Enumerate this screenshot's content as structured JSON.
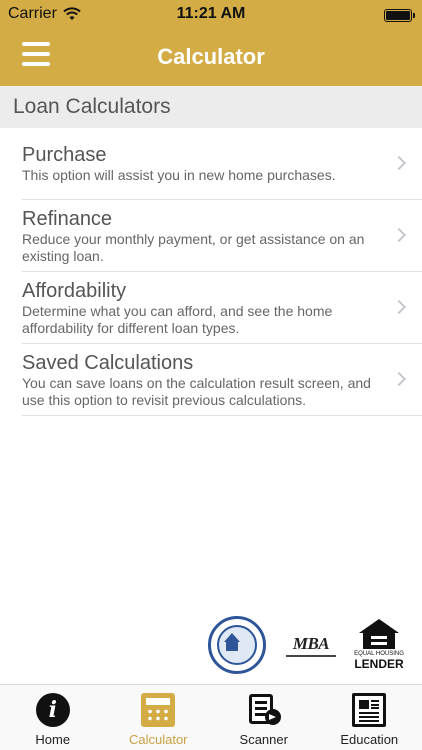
{
  "status_bar": {
    "carrier": "Carrier",
    "time": "11:21 AM"
  },
  "header": {
    "title": "Calculator",
    "menu_icon": "hamburger-menu-icon",
    "background_color": "#d4ac45"
  },
  "section": {
    "title": "Loan Calculators"
  },
  "items": [
    {
      "title": "Purchase",
      "description": "This option will assist you in new home purchases."
    },
    {
      "title": "Refinance",
      "description": "Reduce your monthly payment, or get assistance on an existing loan."
    },
    {
      "title": "Affordability",
      "description": "Determine what you can afford, and see the home affordability for different loan types."
    },
    {
      "title": "Saved Calculations",
      "description": "You can save loans on the calculation result screen, and use this option to revisit previous calculations."
    }
  ],
  "logos": {
    "mba": "MBA",
    "equal_housing_small": "EQUAL HOUSING",
    "equal_housing_big": "LENDER"
  },
  "tabs": [
    {
      "label": "Home",
      "icon": "info-icon",
      "active": false
    },
    {
      "label": "Calculator",
      "icon": "calculator-icon",
      "active": true
    },
    {
      "label": "Scanner",
      "icon": "scanner-icon",
      "active": false
    },
    {
      "label": "Education",
      "icon": "newspaper-icon",
      "active": false
    }
  ],
  "colors": {
    "accent": "#d4ac45",
    "active_tab": "#c9a043"
  }
}
